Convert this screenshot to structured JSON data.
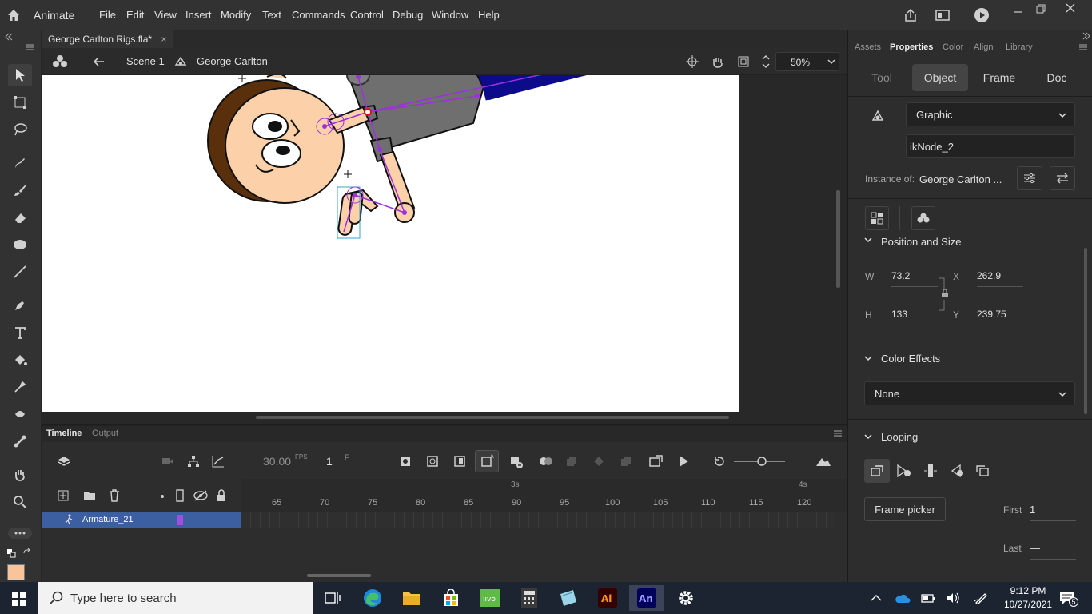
{
  "app": {
    "name": "Animate"
  },
  "menu": [
    "File",
    "Edit",
    "View",
    "Insert",
    "Modify",
    "Text",
    "Commands",
    "Control",
    "Debug",
    "Window",
    "Help"
  ],
  "document": {
    "tab_title": "George Carlton Rigs.fla*"
  },
  "editbar": {
    "scene": "Scene 1",
    "symbol": "George Carlton",
    "zoom": "50%"
  },
  "timeline": {
    "tabs": [
      "Timeline",
      "Output"
    ],
    "fps": "30.00",
    "fps_unit": "FPS",
    "frame": "1",
    "frame_unit": "F",
    "ruler_seconds": [
      "3s",
      "4s"
    ],
    "ruler_frames": [
      "65",
      "70",
      "75",
      "80",
      "85",
      "90",
      "95",
      "100",
      "105",
      "110",
      "115",
      "120"
    ],
    "layer_name": "Armature_21"
  },
  "properties": {
    "panel_tabs": [
      "Assets",
      "Properties",
      "Color",
      "Align",
      "Library"
    ],
    "sub_tabs": [
      "Tool",
      "Object",
      "Frame",
      "Doc"
    ],
    "symbol_type": "Graphic",
    "instance_name": "ikNode_2",
    "instance_of_label": "Instance of:",
    "instance_of_value": "George Carlton ...",
    "position_size_title": "Position and Size",
    "w_label": "W",
    "w_value": "73.2",
    "h_label": "H",
    "h_value": "133",
    "x_label": "X",
    "x_value": "262.9",
    "y_label": "Y",
    "y_value": "239.75",
    "color_effects_title": "Color Effects",
    "color_effect_value": "None",
    "looping_title": "Looping",
    "frame_picker": "Frame picker",
    "first_label": "First",
    "first_value": "1",
    "last_label": "Last",
    "last_value": "—"
  },
  "taskbar": {
    "search_placeholder": "Type here to search",
    "time": "9:12 PM",
    "date": "10/27/2021",
    "notifications": "5"
  },
  "colors": {
    "accent_blue": "#3b5fa0",
    "fill_swatch": "#f9c49a"
  }
}
